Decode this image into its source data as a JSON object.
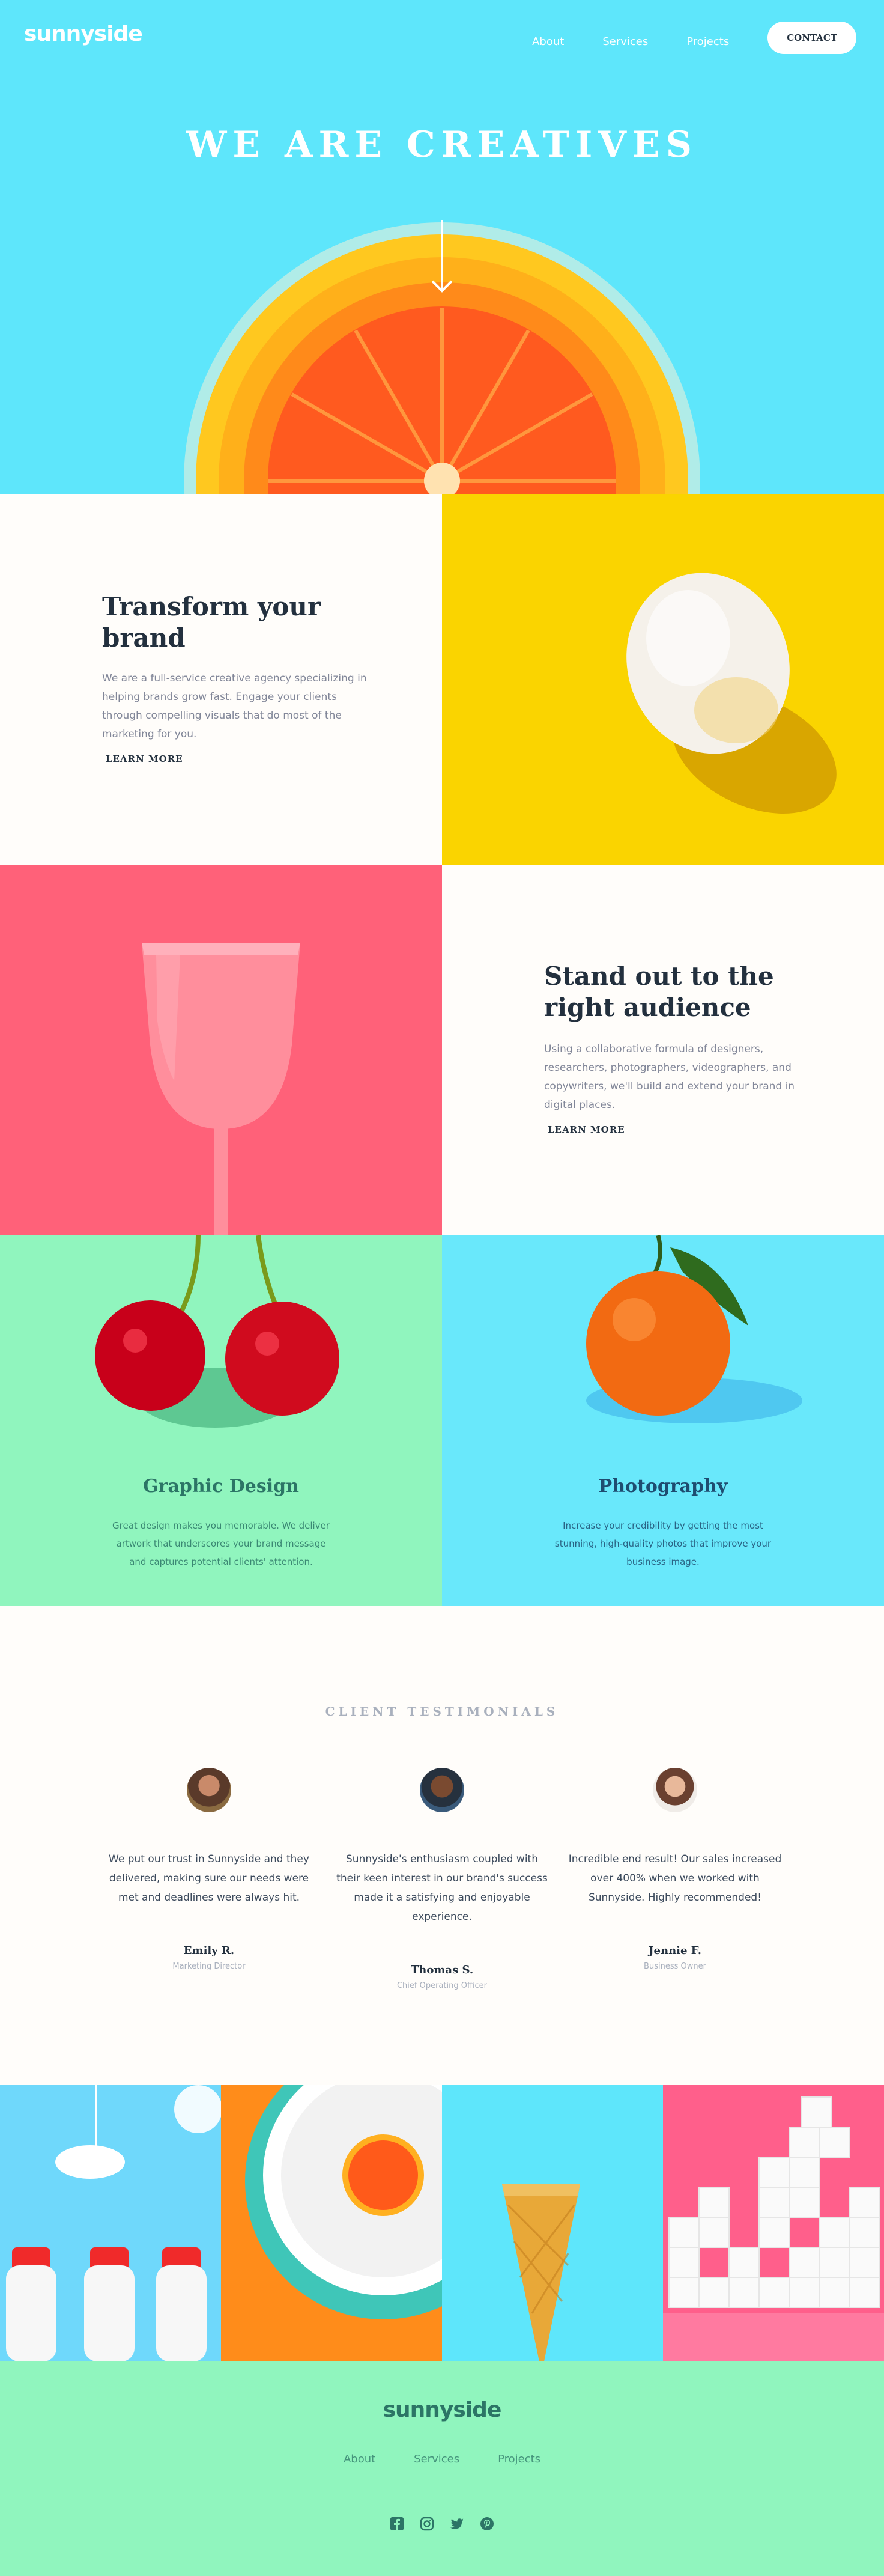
{
  "header": {
    "logo": "sunnyside",
    "nav": [
      "About",
      "Services",
      "Projects"
    ],
    "contact_label": "CONTACT"
  },
  "hero": {
    "title": "WE ARE CREATIVES"
  },
  "features": [
    {
      "title": "Transform your brand",
      "body": "We are a full-service creative agency specializing in helping brands grow fast. Engage your clients through compelling visuals that do most of the marketing for you.",
      "cta": "LEARN MORE",
      "accent": "#fad400"
    },
    {
      "title": "Stand out to the right audience",
      "body": "Using a collaborative formula of designers, researchers, photographers, videographers, and copywriters, we'll build and extend your brand in digital places.",
      "cta": "LEARN MORE",
      "accent": "#fe7865"
    }
  ],
  "services": [
    {
      "title": "Graphic Design",
      "body": "Great design makes you memorable. We deliver artwork that underscores your brand message and captures potential clients' attention.",
      "color": "#2c7566"
    },
    {
      "title": "Photography",
      "body": "Increase your credibility by getting the most stunning, high-quality photos that improve your business image.",
      "color": "#1e4c70"
    }
  ],
  "testimonials": {
    "heading": "CLIENT TESTIMONIALS",
    "items": [
      {
        "quote": "We put our trust in Sunnyside and they delivered, making sure our needs were met and deadlines were always hit.",
        "name": "Emily R.",
        "role": "Marketing Director"
      },
      {
        "quote": "Sunnyside's enthusiasm coupled with their keen interest in our brand's success made it a satisfying and enjoyable experience.",
        "name": "Thomas S.",
        "role": "Chief Operating Officer"
      },
      {
        "quote": "Incredible end result! Our sales increased over 400% when we worked with Sunnyside. Highly recommended!",
        "name": "Jennie F.",
        "role": "Business Owner"
      }
    ]
  },
  "footer": {
    "logo": "sunnyside",
    "nav": [
      "About",
      "Services",
      "Projects"
    ],
    "social_icons": [
      "facebook-icon",
      "instagram-icon",
      "twitter-icon",
      "pinterest-icon"
    ]
  }
}
